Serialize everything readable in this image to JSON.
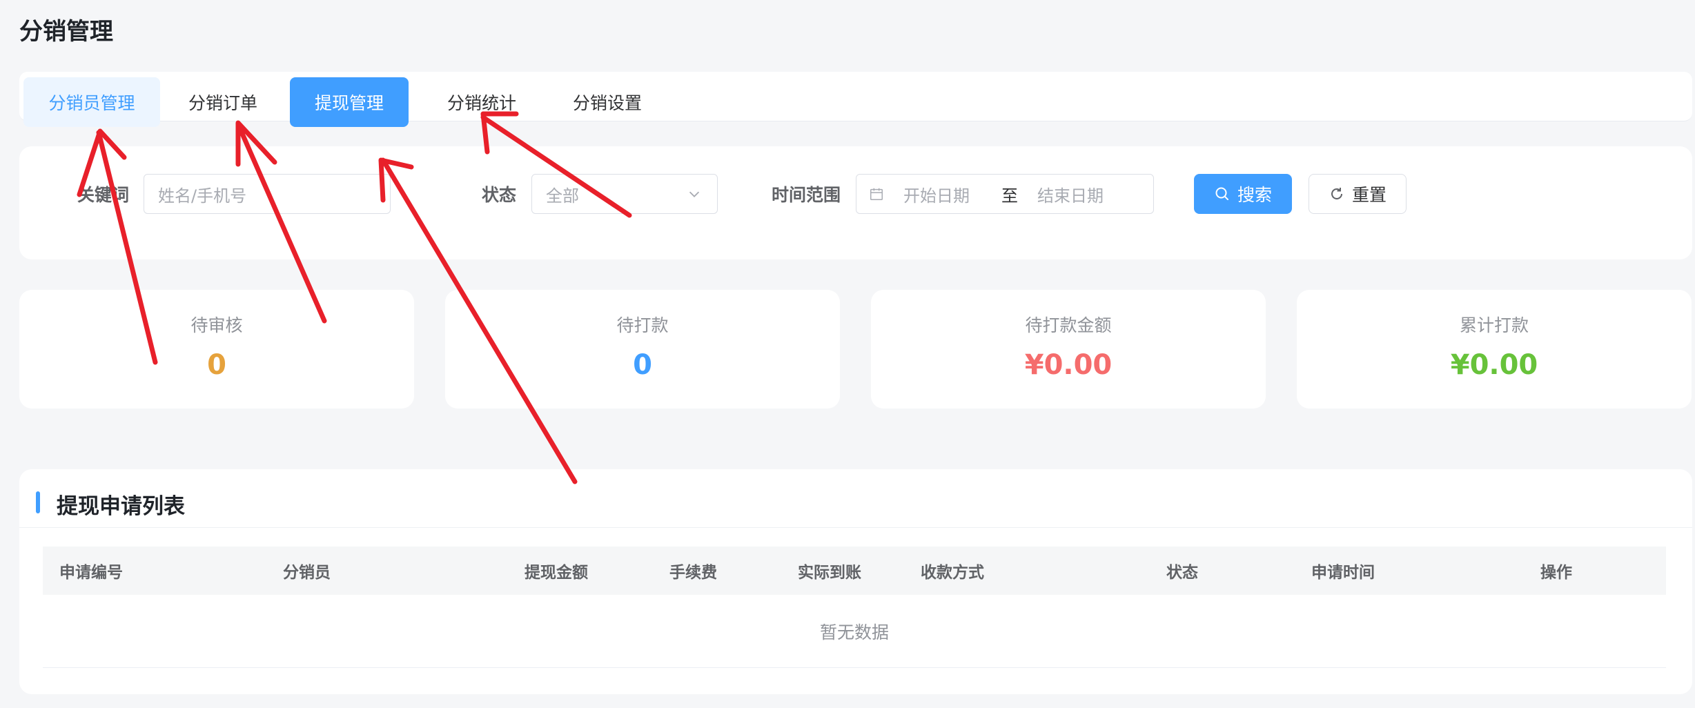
{
  "page": {
    "title": "分销管理"
  },
  "tabs": [
    {
      "label": "分销员管理"
    },
    {
      "label": "分销订单"
    },
    {
      "label": "提现管理"
    },
    {
      "label": "分销统计"
    },
    {
      "label": "分销设置"
    }
  ],
  "filters": {
    "keyword_label": "关键词",
    "keyword_placeholder": "姓名/手机号",
    "status_label": "状态",
    "status_value": "全部",
    "time_label": "时间范围",
    "start_placeholder": "开始日期",
    "separator": "至",
    "end_placeholder": "结束日期",
    "search_label": "搜索",
    "reset_label": "重置"
  },
  "stats": [
    {
      "label": "待审核",
      "value": "0",
      "color": "#e6a23c"
    },
    {
      "label": "待打款",
      "value": "0",
      "color": "#409eff"
    },
    {
      "label": "待打款金额",
      "value": "¥0.00",
      "color": "#f56c6c"
    },
    {
      "label": "累计打款",
      "value": "¥0.00",
      "color": "#67c23a"
    }
  ],
  "table": {
    "title": "提现申请列表",
    "columns": [
      "申请编号",
      "分销员",
      "提现金额",
      "手续费",
      "实际到账",
      "收款方式",
      "状态",
      "申请时间",
      "操作"
    ],
    "empty_text": "暂无数据"
  },
  "colors": {
    "primary": "#409eff",
    "annotation": "#e8202a"
  }
}
